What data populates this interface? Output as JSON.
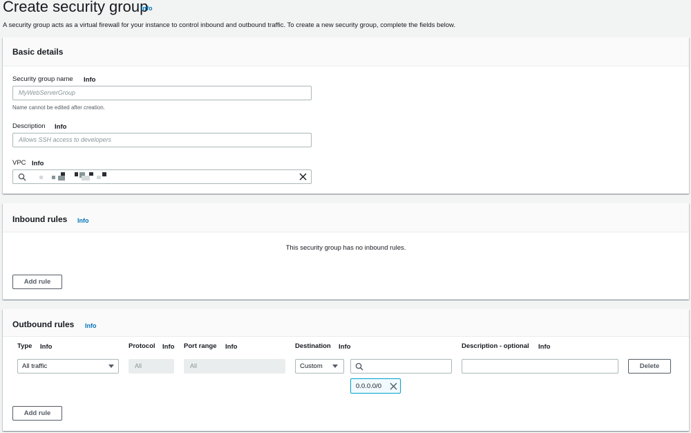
{
  "page": {
    "title": "Create security group",
    "title_info": "Info",
    "description": "A security group acts as a virtual firewall for your instance to control inbound and outbound traffic. To create a new security group, complete the fields below."
  },
  "basic_details": {
    "title": "Basic details",
    "name_label": "Security group name",
    "name_info": "Info",
    "name_placeholder": "MyWebServerGroup",
    "name_hint": "Name cannot be edited after creation.",
    "desc_label": "Description",
    "desc_info": "Info",
    "desc_placeholder": "Allows SSH access to developers",
    "vpc_label": "VPC",
    "vpc_info": "Info"
  },
  "inbound": {
    "title": "Inbound rules",
    "info": "Info",
    "empty_text": "This security group has no inbound rules.",
    "add_rule": "Add rule"
  },
  "outbound": {
    "title": "Outbound rules",
    "info": "Info",
    "columns": {
      "type": "Type",
      "type_info": "Info",
      "protocol": "Protocol",
      "protocol_info": "Info",
      "port_range": "Port range",
      "port_range_info": "Info",
      "destination": "Destination",
      "destination_info": "Info",
      "description": "Description - optional",
      "description_info": "Info"
    },
    "row": {
      "type": "All traffic",
      "protocol": "All",
      "port_range": "All",
      "destination_type": "Custom",
      "cidr_token": "0.0.0.0/0",
      "delete": "Delete"
    },
    "add_rule": "Add rule"
  },
  "colors": {
    "link": "#0073bb",
    "background": "#f2f3f3",
    "border": "#aab7b8"
  }
}
